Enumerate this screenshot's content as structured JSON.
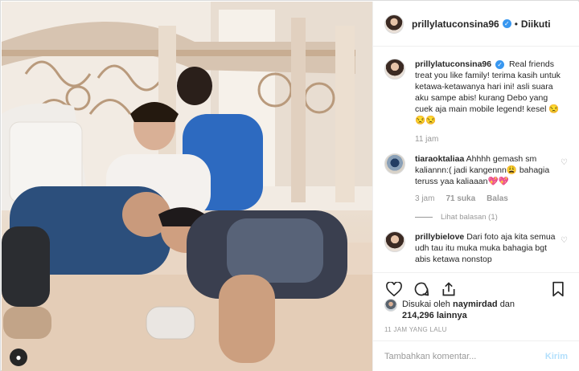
{
  "post": {
    "username": "prillylatuconsina96",
    "follow_label": "Diikuti",
    "separator": "•"
  },
  "caption": {
    "username": "prillylatuconsina96",
    "text": "Real friends treat you like family! terima kasih untuk ketawa-ketawanya hari ini! asli suara aku sampe abis! kurang Debo yang cuek aja main mobile legend! kesel 😒😒😒",
    "time": "11 jam"
  },
  "comments": [
    {
      "username": "tiaraoktaliaa",
      "text": "Ahhhh gemash sm kaliannn:( jadi kangennn😩 bahagia teruss yaa kaliaaan💖💖",
      "time": "3 jam",
      "likes": "71 suka",
      "reply": "Balas",
      "view_replies": "Lihat balasan (1)"
    },
    {
      "username": "prillybielove",
      "text": "Dari foto aja kita semua udh tau itu muka muka bahagia bgt abis ketawa nonstop"
    }
  ],
  "likes": {
    "prefix": "Disukai oleh",
    "user": "naymirdad",
    "conj": "dan",
    "count": "214,296",
    "suffix": "lainnya"
  },
  "date": "11 JAM YANG LALU",
  "composer": {
    "placeholder": "Tambahkan komentar...",
    "send_label": "Kirim"
  },
  "icons": {
    "like": "heart-icon",
    "comment": "comment-icon",
    "share": "share-icon",
    "save": "bookmark-icon",
    "user_tag": "user-icon"
  },
  "colors": {
    "verified": "#3897f0",
    "send_disabled": "#b2dffc",
    "muted": "#999999"
  }
}
